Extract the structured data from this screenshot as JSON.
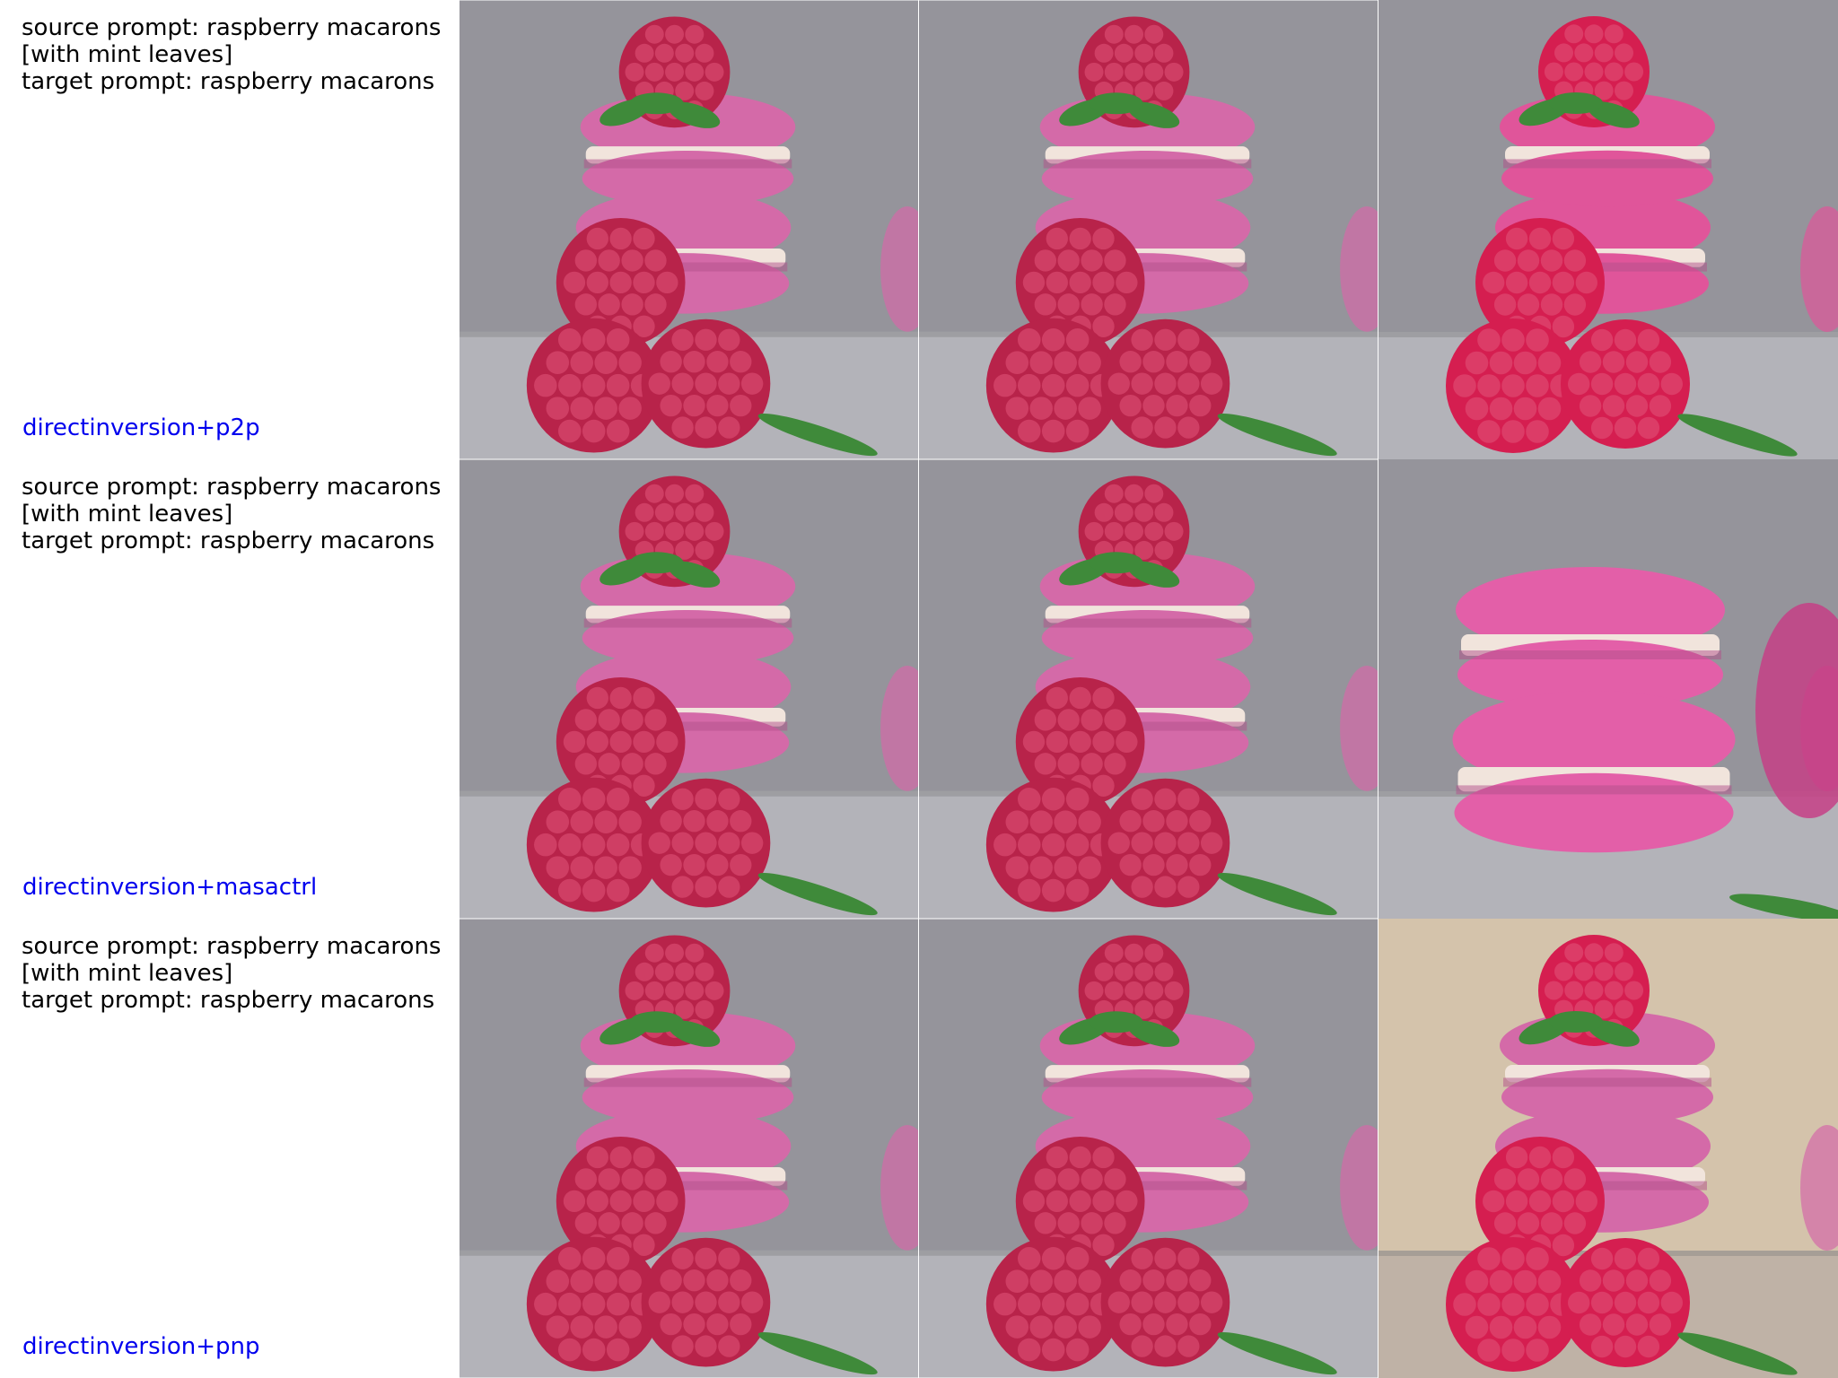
{
  "rows": [
    {
      "source_line1": "source prompt: raspberry macarons",
      "source_line2": "[with mint leaves]",
      "target": "target prompt: raspberry macarons",
      "method": "directinversion+p2p"
    },
    {
      "source_line1": "source prompt: raspberry macarons",
      "source_line2": "[with mint leaves]",
      "target": "target prompt: raspberry macarons",
      "method": "directinversion+masactrl"
    },
    {
      "source_line1": "source prompt: raspberry macarons",
      "source_line2": "[with mint leaves]",
      "target": "target prompt: raspberry macarons",
      "method": "directinversion+pnp"
    }
  ],
  "colors": {
    "method_label": "#0000ee",
    "background_gray": "#8c8a92",
    "macaron_pink": "#d46aa8",
    "raspberry_red": "#b8234a",
    "mint_green": "#3f8a3a"
  }
}
